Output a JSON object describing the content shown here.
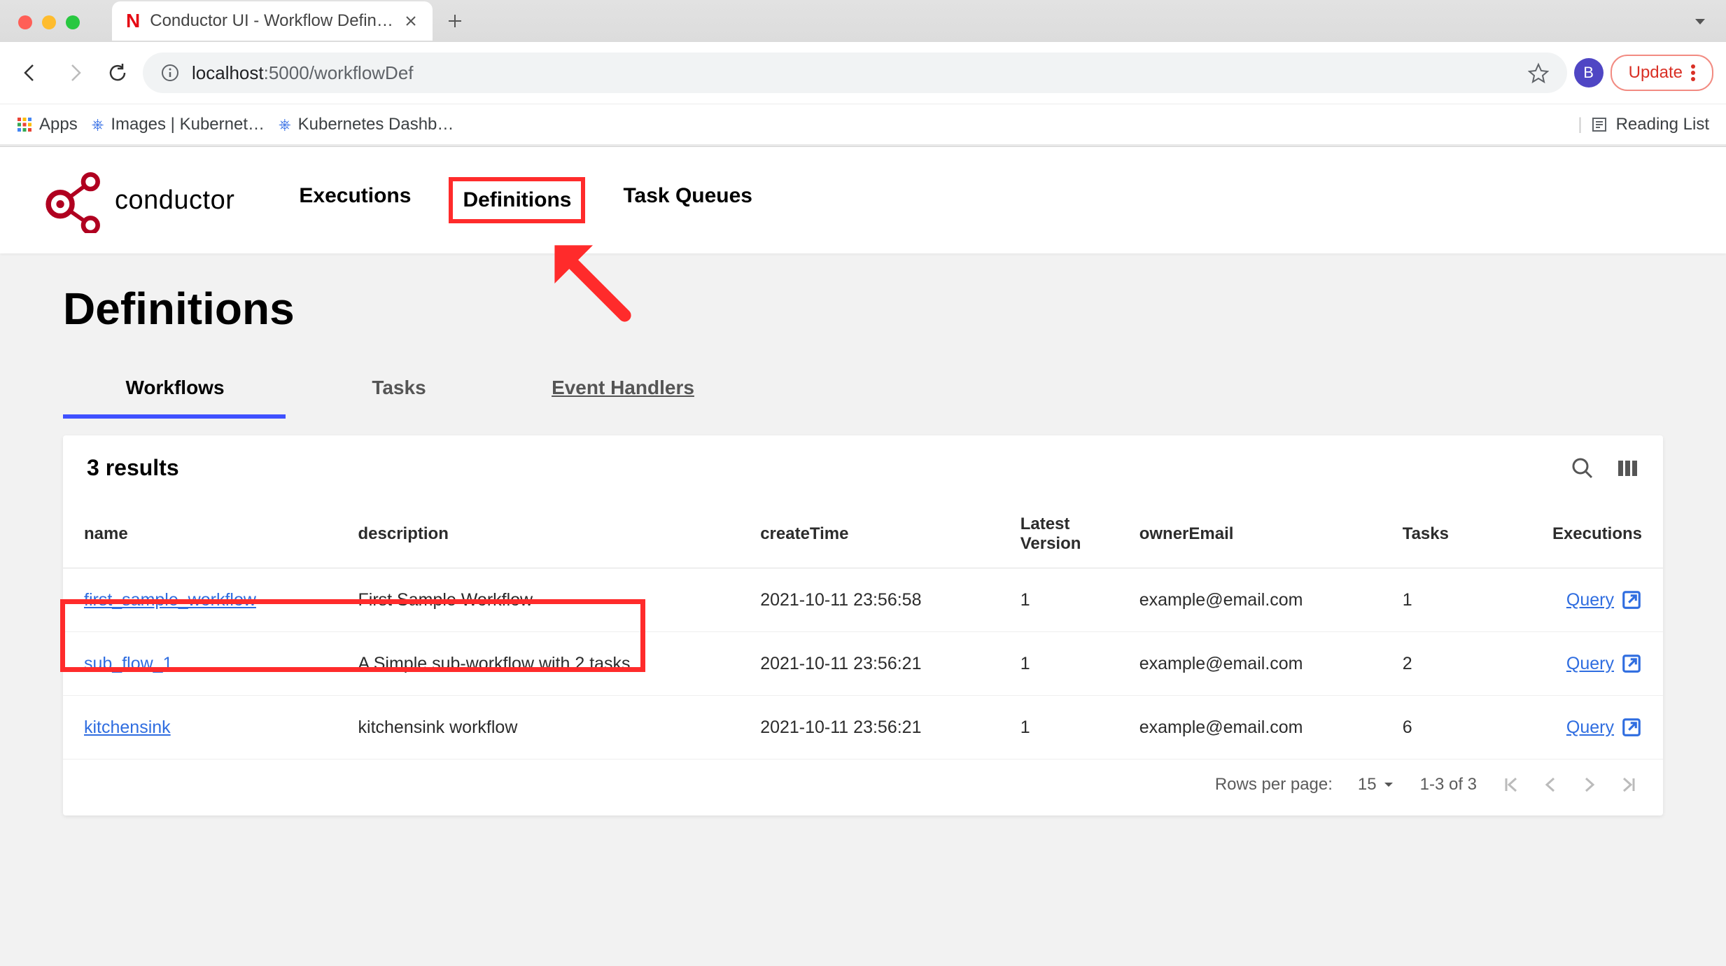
{
  "browser": {
    "tab_title": "Conductor UI - Workflow Defin…",
    "url_host": "localhost",
    "url_port": ":5000",
    "url_path": "/workflowDef",
    "update_label": "Update",
    "profile_letter": "B",
    "bookmarks": {
      "apps": "Apps",
      "bm1": "Images | Kubernet…",
      "bm2": "Kubernetes Dashb…",
      "reading_list": "Reading List"
    }
  },
  "nav": {
    "logo_text": "conductor",
    "items": [
      "Executions",
      "Definitions",
      "Task Queues"
    ]
  },
  "page": {
    "title": "Definitions",
    "tabs": [
      "Workflows",
      "Tasks",
      "Event Handlers"
    ],
    "results_label": "3 results",
    "columns": [
      "name",
      "description",
      "createTime",
      "Latest Version",
      "ownerEmail",
      "Tasks",
      "Executions"
    ],
    "rows": [
      {
        "name": "first_sample_workflow",
        "description": "First Sample Workflow",
        "createTime": "2021-10-11 23:56:58",
        "latestVersion": "1",
        "ownerEmail": "example@email.com",
        "tasks": "1",
        "executions": "Query"
      },
      {
        "name": "sub_flow_1",
        "description": "A Simple sub-workflow with 2 tasks",
        "createTime": "2021-10-11 23:56:21",
        "latestVersion": "1",
        "ownerEmail": "example@email.com",
        "tasks": "2",
        "executions": "Query"
      },
      {
        "name": "kitchensink",
        "description": "kitchensink workflow",
        "createTime": "2021-10-11 23:56:21",
        "latestVersion": "1",
        "ownerEmail": "example@email.com",
        "tasks": "6",
        "executions": "Query"
      }
    ],
    "footer": {
      "rows_per_page_label": "Rows per page:",
      "rows_per_page_value": "15",
      "range_label": "1-3 of 3"
    }
  }
}
